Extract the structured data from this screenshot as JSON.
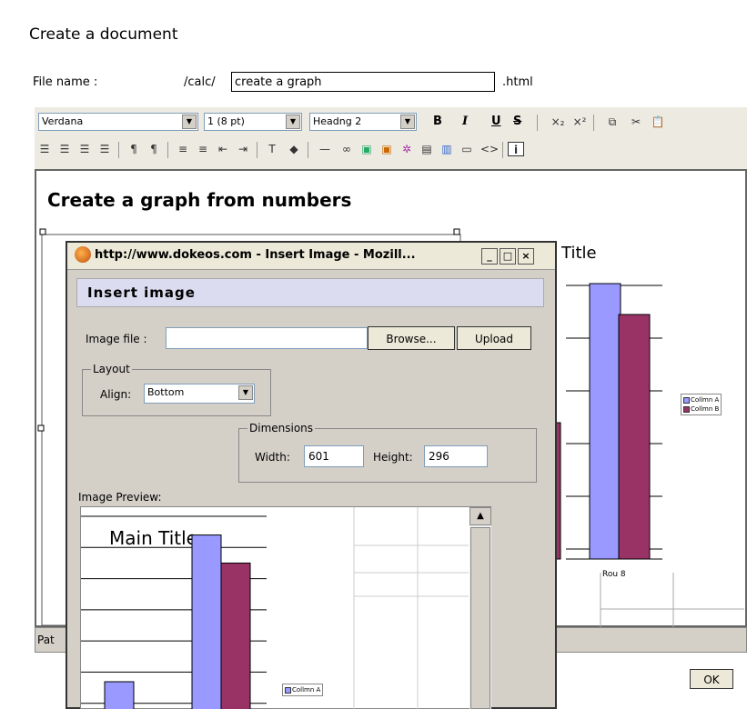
{
  "page": {
    "title": "Create a document",
    "file_name_label": "File name :",
    "file_path": "/calc/",
    "file_name_value": "create a graph",
    "file_ext": ".html"
  },
  "toolbar": {
    "font_family": "Verdana",
    "font_size": "1 (8 pt)",
    "format": "Headng 2",
    "bold_label": "B",
    "italic_label": "I",
    "underline_label": "U",
    "strike_label": "S"
  },
  "editor": {
    "heading": "Create a graph from numbers",
    "path_label": "Pat",
    "ok_label": "OK"
  },
  "background_chart": {
    "title_fragment": "Title",
    "category": "Rou 8",
    "legend": [
      "Collmn A",
      "Collmn B"
    ]
  },
  "dialog": {
    "window_title": "http://www.dokeos.com - Insert Image - Mozill...",
    "header": "Insert image",
    "image_file_label": "Image file :",
    "image_file_value": "",
    "browse_label": "Browse...",
    "upload_label": "Upload",
    "layout_legend": "Layout",
    "align_label": "Align:",
    "align_value": "Bottom",
    "dimensions_legend": "Dimensions",
    "width_label": "Width:",
    "width_value": "601",
    "height_label": "Height:",
    "height_value": "296",
    "preview_label": "Image Preview:",
    "preview_title": "Main Title",
    "preview_legend": "Collmn A"
  },
  "colors": {
    "series_a": "#9999ff",
    "series_b": "#993366",
    "dialog_bg": "#d4d0c8",
    "header_bg": "#dcdcf0"
  },
  "chart_data": {
    "type": "bar",
    "title": "Main Title",
    "categories": [
      "Rou 8"
    ],
    "series": [
      {
        "name": "Collmn A",
        "values": [
          6.4
        ]
      },
      {
        "name": "Collmn B",
        "values": [
          5.5
        ]
      }
    ],
    "ylim": [
      0,
      7
    ]
  }
}
